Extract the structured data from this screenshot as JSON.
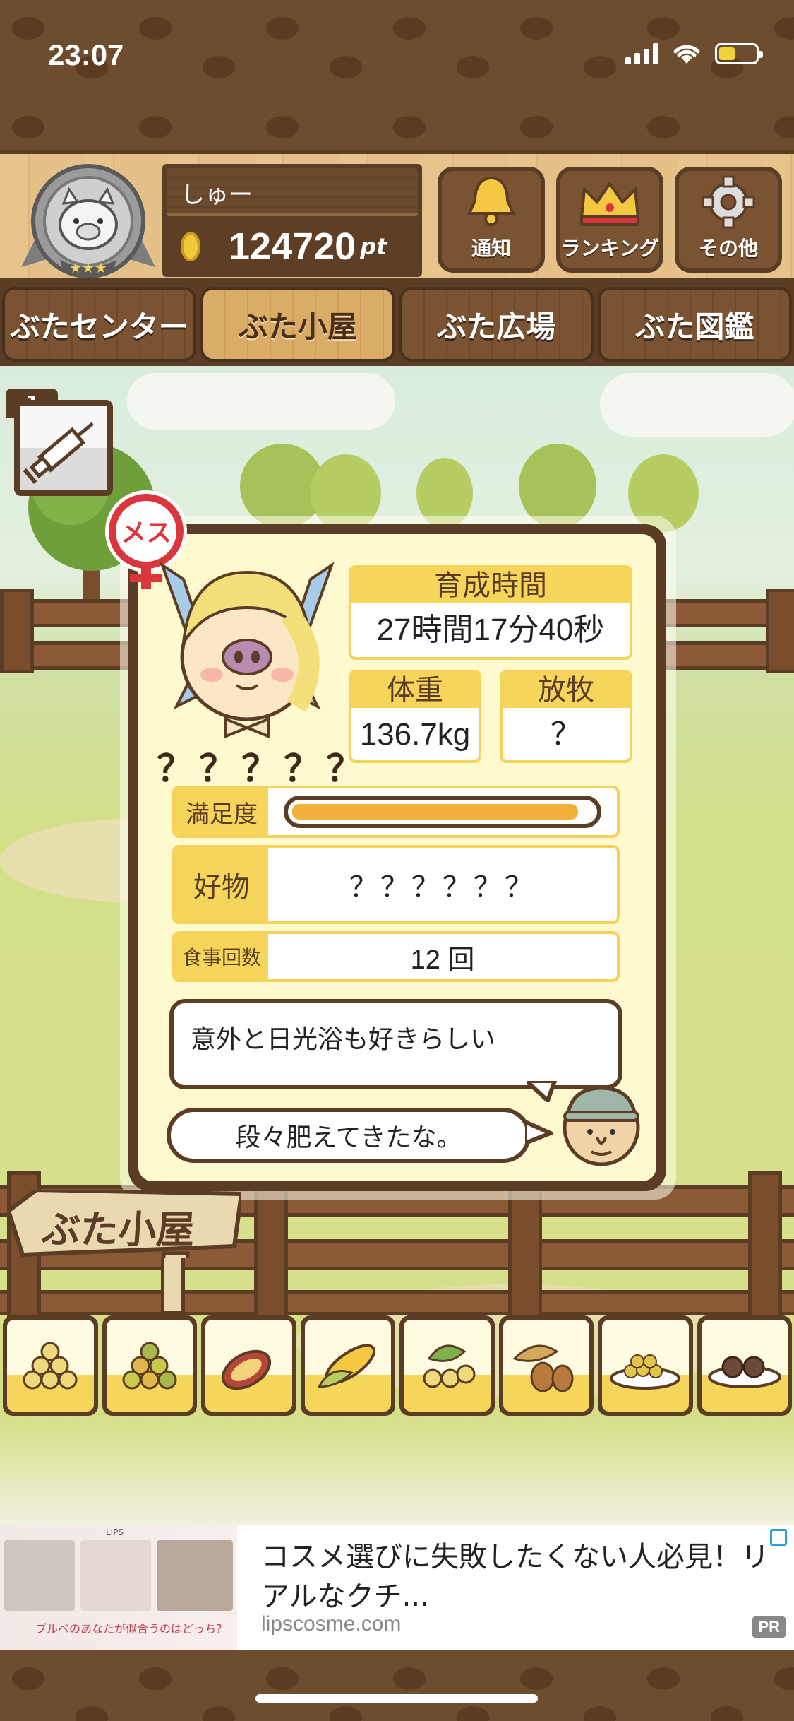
{
  "status_bar": {
    "time": "23:07"
  },
  "header": {
    "username": "しゅー",
    "points": "124720",
    "points_unit": "pt",
    "buttons": [
      {
        "label": "通知",
        "icon": "bell-icon"
      },
      {
        "label": "ランキング",
        "icon": "crown-icon"
      },
      {
        "label": "その他",
        "icon": "gear-icon"
      }
    ]
  },
  "tabs": [
    {
      "label": "ぶたセンター",
      "active": false
    },
    {
      "label": "ぶた小屋",
      "active": true
    },
    {
      "label": "ぶた広場",
      "active": false
    },
    {
      "label": "ぶた図鑑",
      "active": false
    }
  ],
  "item": {
    "count": "1",
    "icon": "syringe-icon"
  },
  "pig_card": {
    "sex_label": "メス",
    "name": "？？？？？",
    "growth_time_label": "育成時間",
    "growth_time": "27時間17分40秒",
    "weight_label": "体重",
    "weight": "136.7kg",
    "grazing_label": "放牧",
    "grazing": "？",
    "satisfaction_label": "満足度",
    "satisfaction": 0.95,
    "favorite_label": "好物",
    "favorite": "？？？？？？",
    "meals_label": "食事回数",
    "meals": "12 回",
    "hint": "意外と日光浴も好きらしい",
    "comment": "段々肥えてきたな。"
  },
  "sign": {
    "label": "ぶた小屋"
  },
  "foods": [
    {
      "icon": "soybeans-icon"
    },
    {
      "icon": "mixed-beans-icon"
    },
    {
      "icon": "sweet-potato-icon"
    },
    {
      "icon": "corn-icon"
    },
    {
      "icon": "ginkgo-icon"
    },
    {
      "icon": "acorn-icon"
    },
    {
      "icon": "bean-dish-icon"
    },
    {
      "icon": "dumpling-plate-icon"
    }
  ],
  "ad": {
    "brand": "LIPS",
    "image_caption": "ブルベのあなたが似合うのはどっち？",
    "title": "コスメ選びに失敗したくない人必見！リアルなクチ...",
    "domain": "lipscosme.com",
    "badge": "PR"
  },
  "colors": {
    "wood_dark": "#5a3d24",
    "wood_light": "#e8c48d",
    "card_bg": "#fef9cf",
    "label_yellow": "#f6d55b",
    "bar_fill": "#f0b03a",
    "female_red": "#d9363e"
  }
}
